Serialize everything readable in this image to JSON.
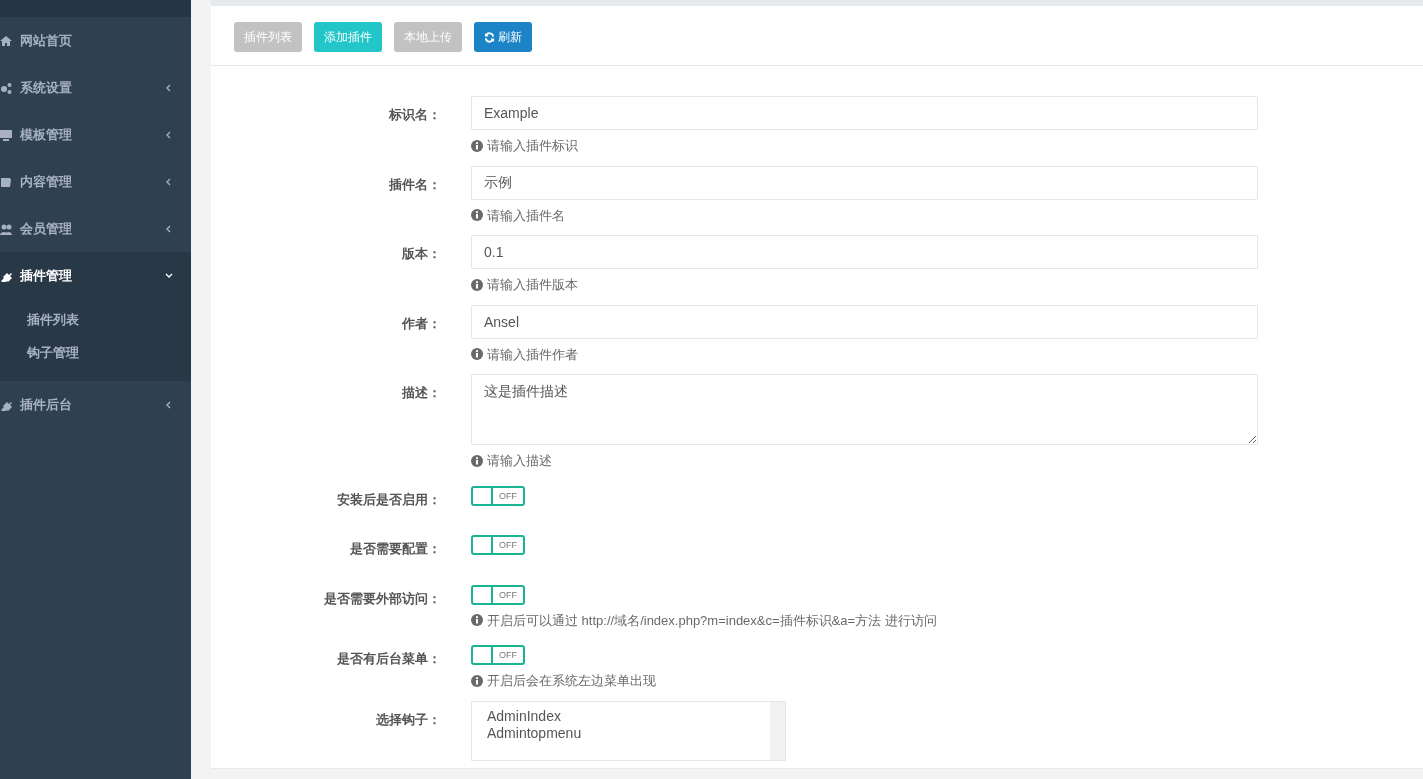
{
  "sidebar": {
    "items": [
      {
        "label": "网站首页",
        "kind": "link",
        "selected": false
      },
      {
        "label": "系统设置",
        "kind": "menu",
        "selected": false,
        "expanded": false
      },
      {
        "label": "模板管理",
        "kind": "menu",
        "selected": false,
        "expanded": false
      },
      {
        "label": "内容管理",
        "kind": "menu",
        "selected": false,
        "expanded": false
      },
      {
        "label": "会员管理",
        "kind": "menu",
        "selected": false,
        "expanded": false
      },
      {
        "label": "插件管理",
        "kind": "menu",
        "selected": true,
        "expanded": true,
        "children": [
          {
            "label": "插件列表"
          },
          {
            "label": "钩子管理"
          }
        ]
      },
      {
        "label": "插件后台",
        "kind": "menu",
        "selected": false,
        "expanded": false
      }
    ]
  },
  "toolbar": {
    "buttons": [
      {
        "label": "插件列表",
        "kind": "text",
        "color": "#c2c2c2"
      },
      {
        "label": "添加插件",
        "kind": "text",
        "color": "#23c6c8"
      },
      {
        "label": "本地上传",
        "kind": "text",
        "color": "#c2c2c2"
      },
      {
        "label": "刷新",
        "kind": "refresh",
        "color": "#1c84c6"
      }
    ]
  },
  "form": {
    "fields": [
      {
        "kind": "input",
        "label": "标识名：",
        "value": "Example",
        "help": "请输入插件标识"
      },
      {
        "kind": "input",
        "label": "插件名：",
        "value": "示例",
        "help": "请输入插件名"
      },
      {
        "kind": "input",
        "label": "版本：",
        "value": "0.1",
        "help": "请输入插件版本"
      },
      {
        "kind": "input",
        "label": "作者：",
        "value": "Ansel",
        "help": "请输入插件作者"
      },
      {
        "kind": "textarea",
        "label": "描述：",
        "value": "这是插件描述",
        "help": "请输入描述"
      },
      {
        "kind": "switch",
        "label": "安装后是否启用：",
        "on": false,
        "state_text": "OFF"
      },
      {
        "kind": "switch",
        "label": "是否需要配置：",
        "on": false,
        "state_text": "OFF"
      },
      {
        "kind": "switch",
        "label": "是否需要外部访问：",
        "on": false,
        "state_text": "OFF",
        "help": "开启后可以通过 http://域名/index.php?m=index&c=插件标识&a=方法 进行访问"
      },
      {
        "kind": "switch",
        "label": "是否有后台菜单：",
        "on": false,
        "state_text": "OFF",
        "help": "开启后会在系统左边菜单出现"
      },
      {
        "kind": "listbox",
        "label": "选择钩子：",
        "options": [
          "AdminIndex",
          "Admintopmenu"
        ]
      }
    ]
  }
}
